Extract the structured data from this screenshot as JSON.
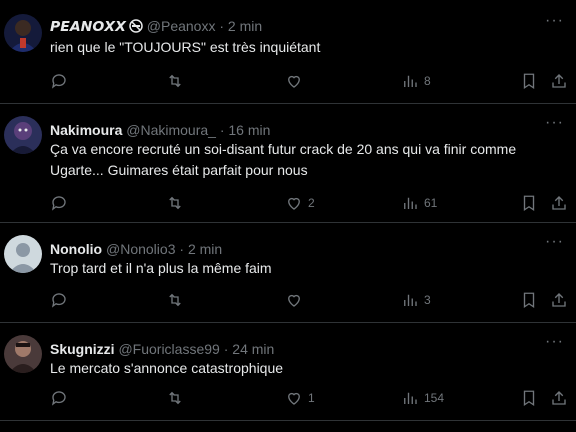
{
  "tweets": [
    {
      "name": "𝙋𝙀𝘼𝙉𝙊𝙓𝙓",
      "handle": "@Peanoxx",
      "sep": "·",
      "time": "2 min",
      "text": "rien que le \"TOUJOURS\" est très inquiétant",
      "replies": "",
      "retweets": "",
      "likes": "",
      "views": "8",
      "avatar_color": "#2a2f55"
    },
    {
      "name": "Nakimoura",
      "handle": "@Nakimoura_",
      "sep": "·",
      "time": "16 min",
      "text": "Ça va encore recruté un soi-disant futur crack de 20 ans qui va finir comme Ugarte... Guimares était parfait pour nous",
      "replies": "",
      "retweets": "",
      "likes": "2",
      "views": "61",
      "avatar_color": "#3a3f6a"
    },
    {
      "name": "Nonolio",
      "handle": "@Nonolio3",
      "sep": "·",
      "time": "2 min",
      "text": "Trop tard et il n'a plus la même faim",
      "replies": "",
      "retweets": "",
      "likes": "",
      "views": "3",
      "avatar_color": "#cfd9de"
    },
    {
      "name": "Skugnizzi",
      "handle": "@Fuoriclasse99",
      "sep": "·",
      "time": "24 min",
      "text": "Le mercato s'annonce catastrophique",
      "replies": "",
      "retweets": "",
      "likes": "1",
      "views": "154",
      "avatar_color": "#6b4a4a"
    }
  ],
  "icons": {
    "more": "more-icon",
    "reply": "reply-icon",
    "retweet": "retweet-icon",
    "like": "heart-icon",
    "views": "views-icon",
    "bookmark": "bookmark-icon",
    "share": "share-icon"
  }
}
